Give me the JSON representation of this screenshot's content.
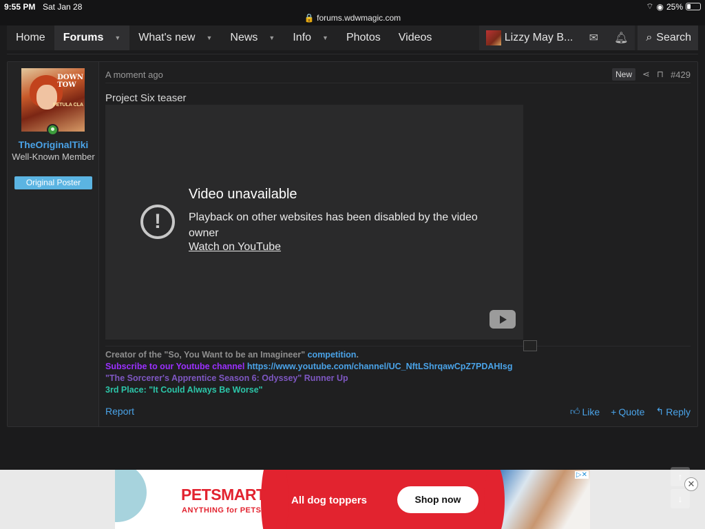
{
  "status_bar": {
    "time": "9:55 PM",
    "date": "Sat Jan 28",
    "url": "forums.wdwmagic.com",
    "battery": "25%"
  },
  "nav": {
    "items": [
      "Home",
      "Forums",
      "What's new",
      "News",
      "Info",
      "Photos",
      "Videos"
    ],
    "user": "Lizzy May B...",
    "search": "Search"
  },
  "post": {
    "time": "A moment ago",
    "new_badge": "New",
    "number": "#429",
    "title": "Project Six teaser",
    "user": {
      "name": "TheOriginalTiki",
      "title": "Well-Known Member",
      "badge": "Original Poster"
    },
    "video": {
      "title": "Video unavailable",
      "message": "Playback on other websites has been disabled by the video owner",
      "link": "Watch on YouTube"
    },
    "signature": {
      "line1_a": "Creator of the \"So, You Want to be an Imagineer\" ",
      "line1_b": "competition",
      "line1_c": ".",
      "line2_a": "Subscribe to our Youtube channel ",
      "line2_b": "https://www.youtube.com/channel/UC_NftLShrqawCpZ7PDAHIsg",
      "line3": "\"The Sorcerer's Apprentice Season 6: Odyssey\" Runner Up",
      "line4": "3rd Place: \"It Could Always Be Worse\""
    },
    "actions": {
      "report": "Report",
      "like": "Like",
      "quote": "Quote",
      "reply": "Reply"
    }
  },
  "ad": {
    "brand": "PETSMART",
    "brand_sub": "ANYTHING for PETS",
    "headline": "All dog toppers",
    "cta": "Shop now"
  }
}
